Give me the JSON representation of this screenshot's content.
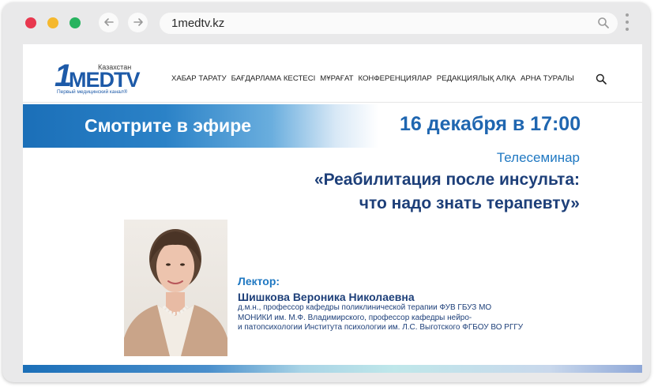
{
  "browser": {
    "url": "1medtv.kz",
    "controls": {
      "close_color": "#e8384f",
      "minimize_color": "#f5b82e",
      "maximize_color": "#27b35f"
    },
    "icons": {
      "back": "arrow-left-icon",
      "forward": "arrow-right-icon",
      "search": "search-icon",
      "menu": "kebab-menu-icon"
    }
  },
  "site": {
    "logo": {
      "country": "Казахстан",
      "brand": "1MEDTV",
      "tagline": "Первый медицинский канал®"
    },
    "menu": [
      "ХАБАР ТАРАТУ",
      "БАҒДАРЛАМА КЕСТЕСІ",
      "МҰРАҒАТ",
      "КОНФЕРЕНЦИЯЛАР",
      "РЕДАКЦИЯЛЫҚ АЛҚА",
      "АРНА ТУРАЛЫ"
    ]
  },
  "banner": {
    "watch_live": "Смотрите в эфире",
    "date": "16 декабря в 17:00",
    "event_type": "Телесеминар",
    "title_line1": "«Реабилитация после инсульта:",
    "title_line2": "что надо знать терапевту»"
  },
  "lecturer": {
    "label": "Лектор:",
    "name": "Шишкова Вероника Николаевна",
    "desc_line1": "д.м.н., профессор кафедры поликлинической терапии ФУВ ГБУЗ МО",
    "desc_line2": "МОНИКИ им. М.Ф. Владимирского, профессор кафедры нейро-",
    "desc_line3": "и патопсихологии Института психологии им. Л.С. Выготского ФГБОУ ВО РГГУ"
  },
  "colors": {
    "brand_blue": "#1d5aa8",
    "title_navy": "#1d3f79",
    "accent_blue": "#1f78c2"
  }
}
